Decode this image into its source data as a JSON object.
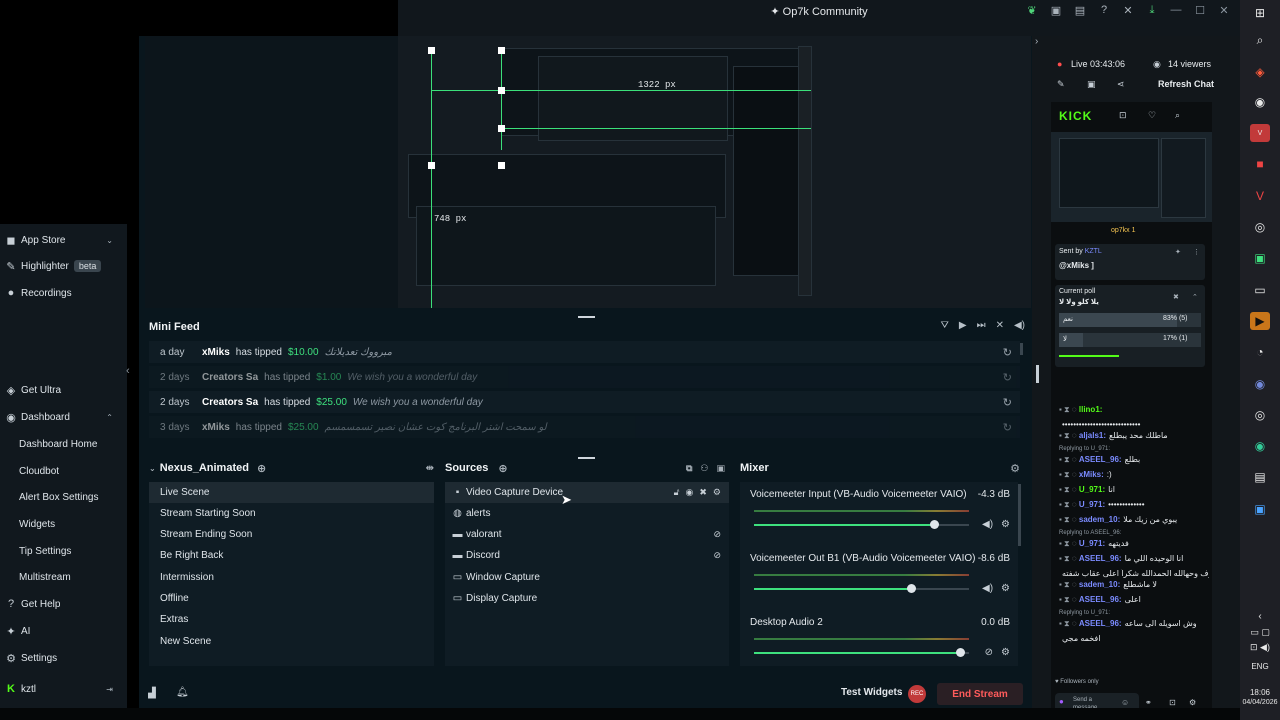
{
  "window": {
    "title": "Op7k Community"
  },
  "nav": {
    "items": [
      {
        "icon": "app-store-icon",
        "label": "App Store",
        "chevron": "⌄"
      },
      {
        "icon": "highlighter-icon",
        "label": "Highlighter",
        "badge": "beta"
      },
      {
        "icon": "recordings-icon",
        "label": "Recordings"
      },
      {
        "icon": "ultra-icon",
        "label": "Get Ultra"
      },
      {
        "icon": "dashboard-icon",
        "label": "Dashboard",
        "chevron": "⌃"
      },
      {
        "label": "Dashboard Home"
      },
      {
        "label": "Cloudbot"
      },
      {
        "label": "Alert Box Settings"
      },
      {
        "label": "Widgets"
      },
      {
        "label": "Tip Settings"
      },
      {
        "label": "Multistream"
      },
      {
        "icon": "help-icon",
        "label": "Get Help"
      },
      {
        "icon": "ai-icon",
        "label": "AI"
      },
      {
        "icon": "settings-icon",
        "label": "Settings"
      },
      {
        "icon": "kick-icon",
        "label": "kztl"
      }
    ]
  },
  "preview": {
    "px_label_1": "1322 px",
    "px_label_2": "748 px"
  },
  "minifeed": {
    "title": "Mini Feed",
    "rows": [
      {
        "time": "a day",
        "user": "xMiks",
        "verb": "has tipped",
        "amount": "$10.00",
        "message": "مبرووك تعديلاتك"
      },
      {
        "time": "2 days",
        "user": "Creators Sa",
        "verb": "has tipped",
        "amount": "$1.00",
        "message": "We wish you a wonderful day"
      },
      {
        "time": "2 days",
        "user": "Creators Sa",
        "verb": "has tipped",
        "amount": "$25.00",
        "message": "We wish you a wonderful day"
      },
      {
        "time": "3 days",
        "user": "xMiks",
        "verb": "has tipped",
        "amount": "$25.00",
        "message": "لو سمحت اشتر البرنامج كوت عشان نصير تسمسمسم"
      }
    ]
  },
  "scenes": {
    "title": "Nexus_Animated",
    "items": [
      "Live Scene",
      "Stream Starting Soon",
      "Stream Ending Soon",
      "Be Right Back",
      "Intermission",
      "Offline",
      "Extras",
      "New Scene"
    ],
    "selected": 0
  },
  "sources": {
    "title": "Sources",
    "items": [
      {
        "icon": "camera-icon",
        "label": "Video Capture Device"
      },
      {
        "icon": "globe-icon",
        "label": "alerts"
      },
      {
        "icon": "folder-icon",
        "label": "valorant"
      },
      {
        "icon": "folder-icon",
        "label": "Discord"
      },
      {
        "icon": "window-icon",
        "label": "Window Capture"
      },
      {
        "icon": "monitor-icon",
        "label": "Display Capture"
      }
    ]
  },
  "mixer": {
    "title": "Mixer",
    "channels": [
      {
        "name": "Voicemeeter Input (VB-Audio Voicemeeter VAIO)",
        "db": "-4.3 dB",
        "level": 0.87
      },
      {
        "name": "Voicemeeter Out B1 (VB-Audio Voicemeeter VAIO)",
        "db": "-8.6 dB",
        "level": 0.76
      },
      {
        "name": "Desktop Audio 2",
        "db": "0.0 dB",
        "level": 1.0
      }
    ]
  },
  "bottombar": {
    "test_widgets": "Test Widgets",
    "rec": "REC",
    "end_stream": "End Stream"
  },
  "chat": {
    "live": "Live 03:43:06",
    "viewers": "14 viewers",
    "refresh": "Refresh Chat",
    "kick_logo": "KICK",
    "sent_by": "Sent by",
    "sent_user": "KZTL",
    "mention": "@xMiks ]",
    "channel": "op7kx 1",
    "poll_label": "Current poll",
    "poll_q": "يلا كلو ولا لا",
    "poll_options": [
      {
        "label": "نعم",
        "pct": "83% (5)",
        "fraction": 0.83
      },
      {
        "label": "لا",
        "pct": "17% (1)",
        "fraction": 0.17
      }
    ],
    "messages": [
      {
        "user": "llino1:",
        "text": ""
      },
      {
        "user": "",
        "text": "••••••••••••••••••••••••••••"
      },
      {
        "user": "aljals1:",
        "text": "ماطلك محد يبطلع"
      },
      {
        "reply": "Replying to U_971:"
      },
      {
        "user": "ASEEL_96:",
        "text": "بطلع"
      },
      {
        "user": "xMiks:",
        "text": ":)"
      },
      {
        "user": "U_971:",
        "text": "انا"
      },
      {
        "user": "U_971:",
        "text": "•••••••••••••"
      },
      {
        "user": "sadem_10:",
        "text": "يبوي من زيك ملا"
      },
      {
        "reply": "Replying to ASEEL_96:"
      },
      {
        "user": "U_971:",
        "text": "فديتهه"
      },
      {
        "user": "ASEEL_96:",
        "text": "انا الوحيده اللي ما"
      },
      {
        "user": "",
        "text": "اتحوف وحهالله الحمدالله شكراً اعلى عقاب شفته"
      },
      {
        "user": "sadem_10:",
        "text": "لا ماشطلع"
      },
      {
        "user": "ASEEL_96:",
        "text": "اعلى"
      },
      {
        "reply": "Replying to U_971:"
      },
      {
        "user": "ASEEL_96:",
        "text": "وش اسويله الى ساعه"
      },
      {
        "user": "",
        "text": "افخمه مجي"
      }
    ],
    "followers_only": "Followers only",
    "send_placeholder": "Send a message"
  },
  "taskbar": {
    "lang": "ENG",
    "time": "18:06",
    "date": "04/04/2026"
  }
}
